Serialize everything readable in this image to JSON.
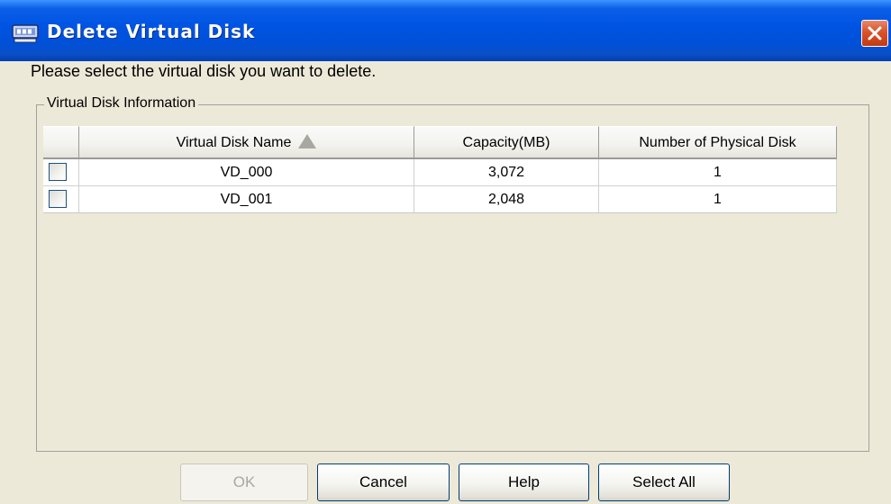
{
  "window": {
    "title": "Delete Virtual Disk"
  },
  "instruction": "Please select the virtual disk you want to delete.",
  "group": {
    "label": "Virtual Disk Information"
  },
  "table": {
    "columns": [
      "Virtual Disk Name",
      "Capacity(MB)",
      "Number of Physical Disk"
    ],
    "sorted_column": "Virtual Disk Name",
    "sort_direction": "ascending",
    "rows": [
      {
        "checked": false,
        "name": "VD_000",
        "capacity": "3,072",
        "physical_disks": "1"
      },
      {
        "checked": false,
        "name": "VD_001",
        "capacity": "2,048",
        "physical_disks": "1"
      }
    ]
  },
  "buttons": {
    "ok": "OK",
    "ok_enabled": false,
    "cancel": "Cancel",
    "help": "Help",
    "select_all": "Select All"
  },
  "colors": {
    "titlebar": "#0054e3",
    "close_button": "#d8532b",
    "window_background": "#ece9d8"
  },
  "icons": {
    "titlebar": "disk-icon",
    "close": "close-icon",
    "sort": "sort-ascending-icon"
  }
}
